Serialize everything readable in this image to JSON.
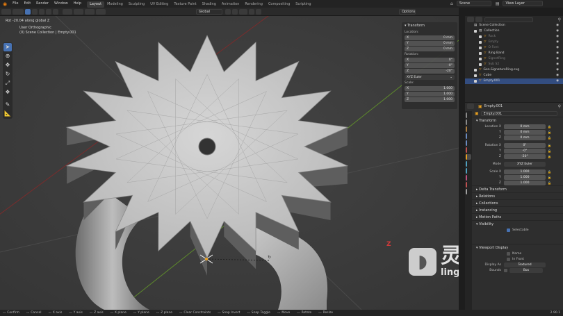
{
  "menu": [
    "File",
    "Edit",
    "Render",
    "Window",
    "Help"
  ],
  "workspaces": [
    "Layout",
    "Modeling",
    "Sculpting",
    "UV Editing",
    "Texture Paint",
    "Shading",
    "Animation",
    "Rendering",
    "Compositing",
    "Scripting"
  ],
  "active_workspace": "Layout",
  "scene_name": "Scene",
  "view_layer": "View Layer",
  "header": {
    "orientation": "Global",
    "options": "Options"
  },
  "viewport": {
    "op_text": "Rot -20.04 along global Z",
    "view_name": "User Orthographic",
    "context": "(0) Scene Collection | Empty.001",
    "axis_label": "Z",
    "watermark_cn": "灵感中国",
    "watermark_url": "lingganchina.com"
  },
  "npanel": {
    "title": "Transform",
    "location_label": "Location:",
    "location": [
      {
        "axis": "X",
        "value": "0 mm"
      },
      {
        "axis": "Y",
        "value": "0 mm"
      },
      {
        "axis": "Z",
        "value": "0 mm"
      }
    ],
    "rotation_label": "Rotation:",
    "rotation": [
      {
        "axis": "X",
        "value": "0°"
      },
      {
        "axis": "Y",
        "value": "-0°"
      },
      {
        "axis": "Z",
        "value": "-20°"
      }
    ],
    "rotation_mode": "XYZ Euler",
    "scale_label": "Scale:",
    "scale": [
      {
        "axis": "X",
        "value": "1.000"
      },
      {
        "axis": "Y",
        "value": "1.000"
      },
      {
        "axis": "Z",
        "value": "1.000"
      }
    ],
    "tabs": [
      "Item",
      "Tool",
      "View",
      "BoolTool",
      "QuadRemesh",
      "JewelCraft",
      "ScreenCast Keys"
    ]
  },
  "outliner": {
    "rows": [
      {
        "label": "Scene Collection",
        "indent": 0,
        "state": "normal"
      },
      {
        "label": "Collection",
        "indent": 1,
        "state": "normal"
      },
      {
        "label": "Rock",
        "indent": 2,
        "state": "dim"
      },
      {
        "label": "Empty",
        "indent": 2,
        "state": "dim"
      },
      {
        "label": "O Font",
        "indent": 2,
        "state": "dim"
      },
      {
        "label": "Ring Band",
        "indent": 2,
        "state": "normal"
      },
      {
        "label": "SignetRing",
        "indent": 2,
        "state": "dim"
      },
      {
        "label": "Sub S2",
        "indent": 2,
        "state": "dim"
      },
      {
        "label": "Gen.SignatureRing.svg",
        "indent": 1,
        "state": "normal"
      },
      {
        "label": "Cube",
        "indent": 1,
        "state": "normal"
      },
      {
        "label": "Empty.001",
        "indent": 1,
        "state": "sel"
      }
    ]
  },
  "properties": {
    "object_name": "Empty.001",
    "data_name": "Empty.001",
    "transform": "Transform",
    "location_x_label": "Location X",
    "rows": [
      {
        "label": "Location X",
        "value": "0 mm"
      },
      {
        "label": "Y",
        "value": "0 mm"
      },
      {
        "label": "Z",
        "value": "0 mm"
      },
      {
        "label": "Rotation X",
        "value": "0°"
      },
      {
        "label": "Y",
        "value": "-0°"
      },
      {
        "label": "Z",
        "value": "-20°"
      },
      {
        "label": "Mode",
        "value": "XYZ Euler"
      },
      {
        "label": "Scale X",
        "value": "1.000"
      },
      {
        "label": "Y",
        "value": "1.000"
      },
      {
        "label": "Z",
        "value": "1.000"
      }
    ],
    "sections": [
      "Delta Transform",
      "Relations",
      "Collections",
      "Instancing",
      "Motion Paths",
      "Visibility"
    ],
    "selectable": "Selectable",
    "viewport_display": "Viewport Display",
    "name_label": "Name",
    "in_front": "In Front",
    "display_as_label": "Display As",
    "display_as": "Textured",
    "bounds_label": "Bounds",
    "bounds_value": "Box"
  },
  "status": [
    "Confirm",
    "Cancel",
    "X axis",
    "Y axis",
    "Z axis",
    "X plane",
    "Y plane",
    "Z plane",
    "Clear Constraints",
    "Snap Invert",
    "Snap Toggle",
    "Move",
    "Rotate",
    "Resize"
  ],
  "version": "2.90.1"
}
